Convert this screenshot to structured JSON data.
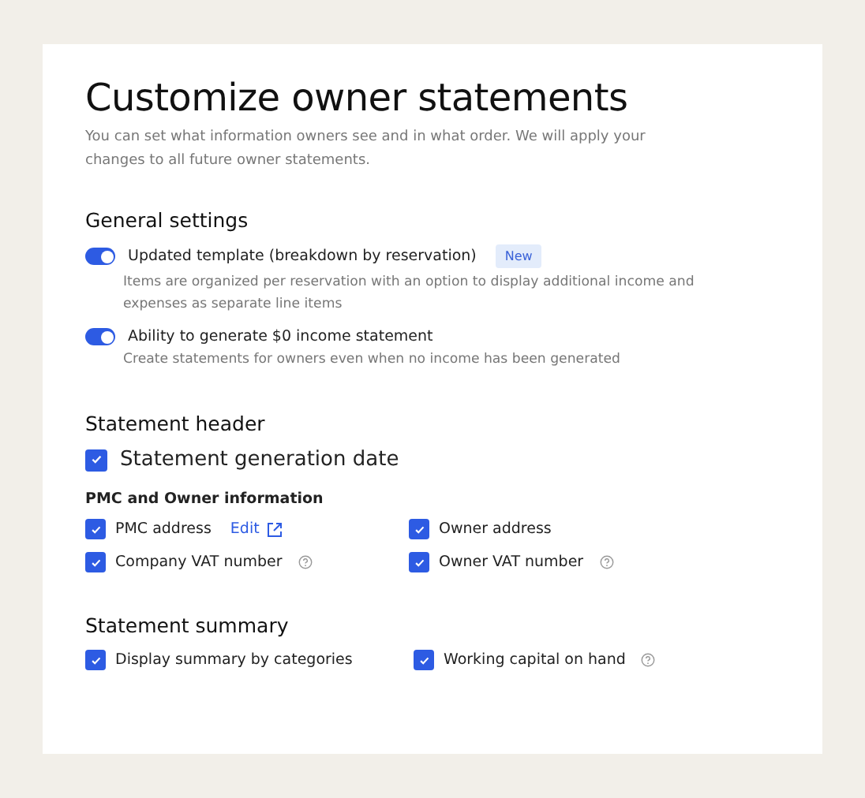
{
  "title": "Customize owner statements",
  "subtitle": "You can set what information owners see and in what order. We will apply your changes to all future owner statements.",
  "general_settings": {
    "heading": "General settings",
    "toggles": [
      {
        "label": "Updated template (breakdown by reservation)",
        "badge": "New",
        "description": "Items are organized per reservation with an option to display additional income and expenses as separate line items",
        "on": true
      },
      {
        "label": "Ability to generate $0 income statement",
        "description": "Create statements for owners even when no income has been generated",
        "on": true
      }
    ]
  },
  "statement_header": {
    "heading": "Statement header",
    "main_option": {
      "label": "Statement generation date",
      "checked": true
    },
    "subheading": "PMC and Owner information",
    "options": [
      {
        "label": "PMC address",
        "checked": true,
        "link": "Edit"
      },
      {
        "label": "Owner address",
        "checked": true
      },
      {
        "label": "Company VAT number",
        "checked": true,
        "help": true
      },
      {
        "label": "Owner VAT number",
        "checked": true,
        "help": true
      }
    ]
  },
  "statement_summary": {
    "heading": "Statement summary",
    "options": [
      {
        "label": "Display summary by categories",
        "checked": true
      },
      {
        "label": "Working capital on hand",
        "checked": true,
        "help": true
      }
    ]
  }
}
